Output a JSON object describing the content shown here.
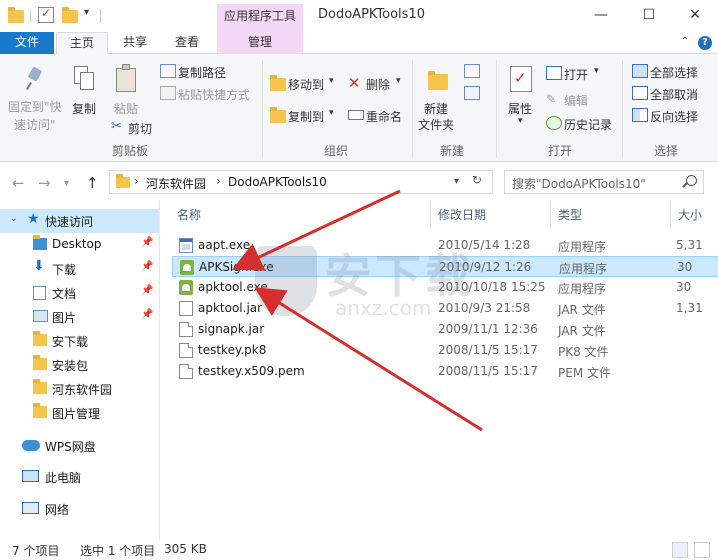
{
  "window": {
    "title": "DodoAPKTools10",
    "context_tab": "应用程序工具",
    "controls": {
      "minimize": "—",
      "maximize": "☐",
      "close": "✕"
    }
  },
  "tabs": {
    "file": "文件",
    "home": "主页",
    "share": "共享",
    "view": "查看",
    "manage": "管理"
  },
  "ribbon": {
    "clipboard": {
      "pin": "固定到\"快速访问\"",
      "pin_line1": "固定到\"快",
      "pin_line2": "速访问\"",
      "copy": "复制",
      "paste": "粘贴",
      "copy_path": "复制路径",
      "paste_shortcut": "粘贴快捷方式",
      "cut": "剪切",
      "label": "剪贴板"
    },
    "organize": {
      "move_to": "移动到",
      "copy_to": "复制到",
      "delete": "删除",
      "rename": "重命名",
      "label": "组织"
    },
    "new": {
      "new_folder_line1": "新建",
      "new_folder_line2": "文件夹",
      "label": "新建"
    },
    "open": {
      "properties": "属性",
      "open": "打开",
      "edit": "编辑",
      "history": "历史记录",
      "label": "打开"
    },
    "select": {
      "select_all": "全部选择",
      "select_none": "全部取消",
      "invert": "反向选择",
      "label": "选择"
    }
  },
  "address": {
    "crumbs": [
      "河东软件园",
      "DodoAPKTools10"
    ],
    "search_placeholder": "搜索\"DodoAPKTools10\""
  },
  "nav": {
    "quick_access": "快速访问",
    "items": [
      "Desktop",
      "下载",
      "文档",
      "图片",
      "安下载",
      "安装包",
      "河东软件园",
      "图片管理"
    ],
    "wps": "WPS网盘",
    "this_pc": "此电脑",
    "network": "网络"
  },
  "list": {
    "columns": {
      "name": "名称",
      "date": "修改日期",
      "type": "类型",
      "size": "大小"
    },
    "files": [
      {
        "name": "aapt.exe",
        "date": "2010/5/14 1:28",
        "type": "应用程序",
        "size": "5,31"
      },
      {
        "name": "APKSign.exe",
        "date": "2010/9/12 1:26",
        "type": "应用程序",
        "size": "30"
      },
      {
        "name": "apktool.exe",
        "date": "2010/10/18 15:25",
        "type": "应用程序",
        "size": "30"
      },
      {
        "name": "apktool.jar",
        "date": "2010/9/3 21:58",
        "type": "JAR 文件",
        "size": "1,31"
      },
      {
        "name": "signapk.jar",
        "date": "2009/11/1 12:36",
        "type": "JAR 文件",
        "size": ""
      },
      {
        "name": "testkey.pk8",
        "date": "2008/11/5 15:17",
        "type": "PK8 文件",
        "size": ""
      },
      {
        "name": "testkey.x509.pem",
        "date": "2008/11/5 15:17",
        "type": "PEM 文件",
        "size": ""
      }
    ]
  },
  "status": {
    "count": "7 个项目",
    "selected": "选中 1 个项目",
    "size": "305 KB"
  },
  "watermark": {
    "big": "安下载",
    "small": "anxz.com"
  },
  "colors": {
    "accent": "#1979ca",
    "selection": "#cce8ff",
    "arrow": "#d32f2f"
  }
}
